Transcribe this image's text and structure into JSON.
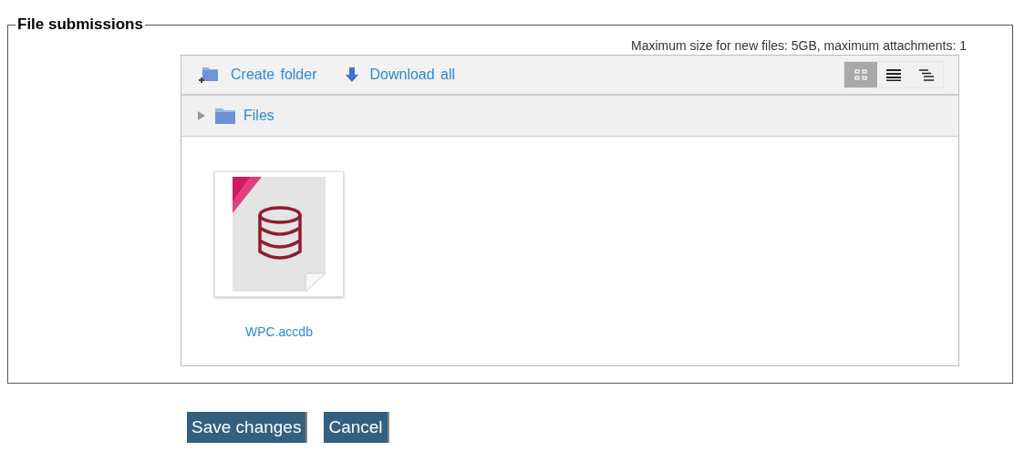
{
  "fieldset": {
    "legend": "File submissions"
  },
  "limits": "Maximum size for new files: 5GB, maximum attachments: 1",
  "toolbar": {
    "actions": [
      {
        "kind": "create-folder",
        "label": "Create folder"
      },
      {
        "kind": "download",
        "label": "Download all"
      }
    ],
    "view_modes": [
      {
        "kind": "icons",
        "selected": true
      },
      {
        "kind": "list",
        "selected": false
      },
      {
        "kind": "tree",
        "selected": false
      }
    ]
  },
  "path": [
    {
      "label": "Files"
    }
  ],
  "files": [
    {
      "name": "WPC.accdb",
      "kind": "database"
    }
  ],
  "buttons": [
    {
      "label": "Save changes"
    },
    {
      "label": "Cancel"
    }
  ]
}
